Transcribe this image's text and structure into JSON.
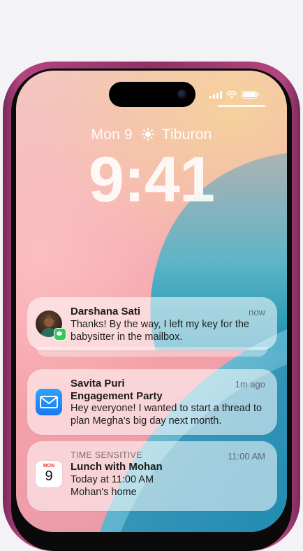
{
  "status_bar": {
    "signal_icon": "cellular-signal-icon",
    "wifi_icon": "wifi-icon",
    "battery_icon": "battery-icon"
  },
  "lock_screen": {
    "date": "Mon 9",
    "weather_icon": "sun-icon",
    "location": "Tiburon",
    "time": "9:41"
  },
  "notifications": [
    {
      "sender": "Darshana Sati",
      "time": "now",
      "message": "Thanks! By the way, I left my key for the babysitter in the mailbox.",
      "app_icon": "messages-icon"
    },
    {
      "sender": "Savita Puri",
      "subject": "Engagement Party",
      "time": "1m ago",
      "message": "Hey everyone! I wanted to start a thread to plan Megha's big day next month.",
      "app_icon": "mail-icon"
    },
    {
      "label": "TIME SENSITIVE",
      "title": "Lunch with Mohan",
      "time": "11:00 AM",
      "line1": "Today at 11:00 AM",
      "line2": "Mohan's home",
      "app_icon": "calendar-icon",
      "calendar_month": "MON",
      "calendar_day": "9"
    }
  ]
}
